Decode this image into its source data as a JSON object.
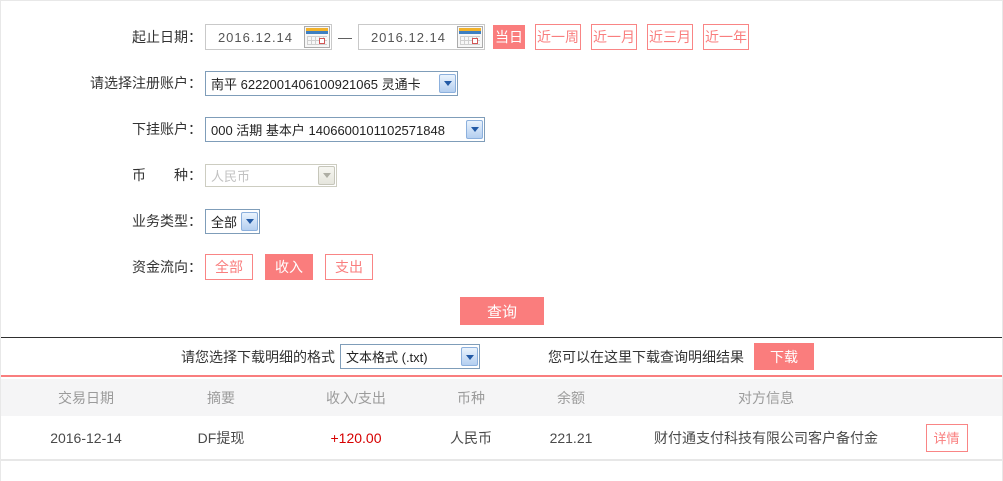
{
  "colors": {
    "accent": "#fa7d7d",
    "accent_outline": "#f98585",
    "amount_positive": "#d60000",
    "divider_dark": "#2f2f2f",
    "divider_red": "#f97e7e",
    "table_header_bg": "#f5f5f6"
  },
  "filters": {
    "date_range": {
      "label": "起止日期：",
      "start": "2016.12.14",
      "end": "2016.12.14",
      "separator": "—",
      "quick_buttons": [
        {
          "label": "当日",
          "active": true
        },
        {
          "label": "近一周",
          "active": false
        },
        {
          "label": "近一月",
          "active": false
        },
        {
          "label": "近三月",
          "active": false
        },
        {
          "label": "近一年",
          "active": false
        }
      ]
    },
    "register_account": {
      "label": "请选择注册账户：",
      "value": "南平 6222001406100921065 灵通卡"
    },
    "sub_account": {
      "label": "下挂账户：",
      "value": "000 活期 基本户 1406600101102571848"
    },
    "currency": {
      "label": "币　　种：",
      "value": "人民币",
      "disabled": true
    },
    "business_type": {
      "label": "业务类型：",
      "value": "全部"
    },
    "fund_flow": {
      "label": "资金流向：",
      "options": [
        {
          "label": "全部",
          "active": false
        },
        {
          "label": "收入",
          "active": true
        },
        {
          "label": "支出",
          "active": false
        }
      ]
    },
    "query_button": "查询"
  },
  "download": {
    "format_label": "请您选择下载明细的格式",
    "format_value": "文本格式 (.txt)",
    "hint": "您可以在这里下载查询明细结果",
    "button": "下载"
  },
  "table": {
    "headers": [
      "交易日期",
      "摘要",
      "收入/支出",
      "币种",
      "余额",
      "对方信息"
    ],
    "rows": [
      {
        "date": "2016-12-14",
        "summary": "DF提现",
        "amount": "+120.00",
        "currency": "人民币",
        "balance": "221.21",
        "counterparty": "财付通支付科技有限公司客户备付金",
        "detail_button": "详情"
      }
    ]
  }
}
